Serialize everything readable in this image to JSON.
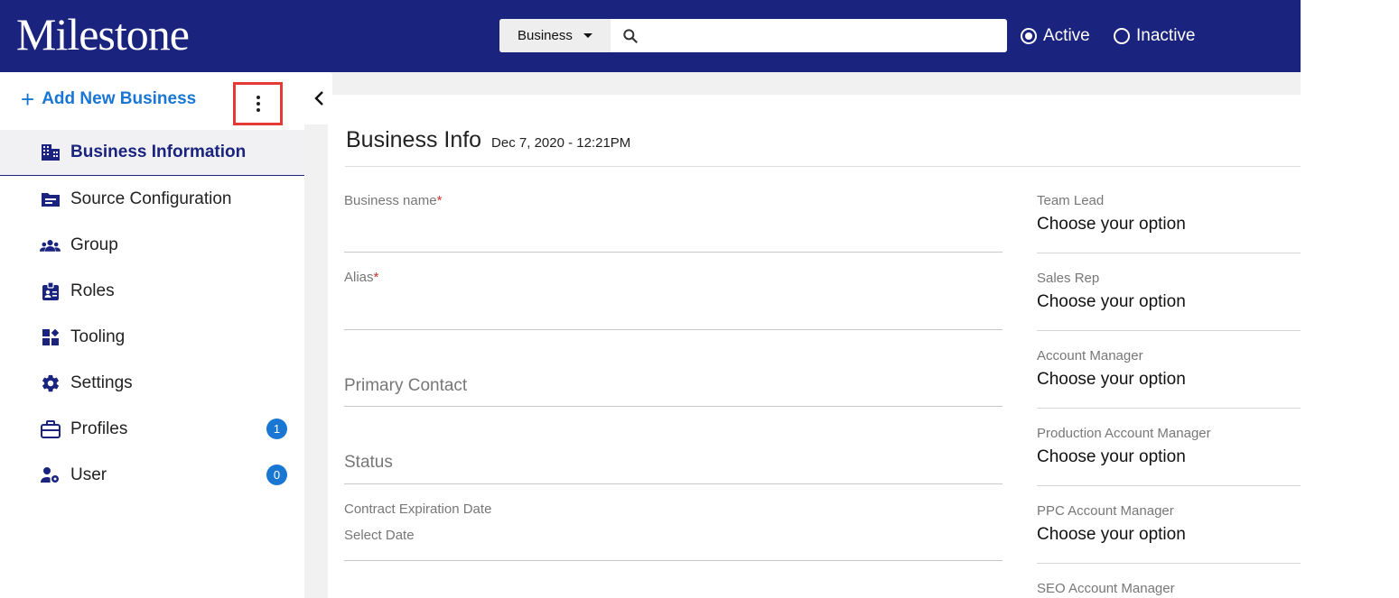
{
  "header": {
    "logo": "Milestone",
    "search": {
      "scope": "Business",
      "placeholder": ""
    },
    "status_filter": [
      {
        "label": "Active",
        "checked": true
      },
      {
        "label": "Inactive",
        "checked": false
      }
    ],
    "background_color": "#1a237e"
  },
  "sidebar": {
    "add_new_label": "Add New Business",
    "items": [
      {
        "label": "Business Information",
        "icon": "building-icon",
        "active": true
      },
      {
        "label": "Source Configuration",
        "icon": "folder-icon"
      },
      {
        "label": "Group",
        "icon": "group-icon"
      },
      {
        "label": "Roles",
        "icon": "id-badge-icon"
      },
      {
        "label": "Tooling",
        "icon": "widgets-icon"
      },
      {
        "label": "Settings",
        "icon": "gear-icon"
      },
      {
        "label": "Profiles",
        "icon": "briefcase-icon",
        "badge": "1"
      },
      {
        "label": "User",
        "icon": "user-settings-icon",
        "badge": "0"
      }
    ]
  },
  "main": {
    "title": "Business Info",
    "timestamp": "Dec 7, 2020 - 12:21PM",
    "fields": {
      "business_name_label": "Business name",
      "alias_label": "Alias",
      "required_mark": "*",
      "primary_contact_label": "Primary Contact",
      "status_label": "Status",
      "contract_expiration_label": "Contract Expiration Date",
      "contract_expiration_value": "Select Date"
    },
    "right_fields": [
      {
        "label": "Team Lead",
        "value": "Choose your option"
      },
      {
        "label": "Sales Rep",
        "value": "Choose your option"
      },
      {
        "label": "Account Manager",
        "value": "Choose your option"
      },
      {
        "label": "Production Account Manager",
        "value": "Choose your option"
      },
      {
        "label": "PPC Account Manager",
        "value": "Choose your option"
      },
      {
        "label": "SEO Account Manager",
        "value": ""
      }
    ]
  }
}
